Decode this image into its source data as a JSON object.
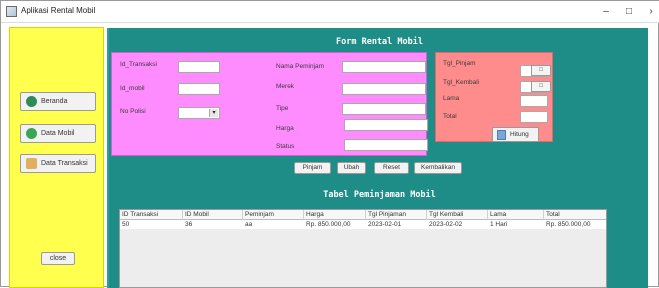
{
  "window": {
    "title": "Aplikasi Rental Mobil",
    "minimize": "–",
    "maximize": "□",
    "close": "›"
  },
  "sidebar": {
    "items": [
      {
        "label": "Beranda",
        "icon": "home-icon"
      },
      {
        "label": "Data Mobil",
        "icon": "car-icon"
      },
      {
        "label": "Data Transaksi",
        "icon": "handshake-icon"
      }
    ],
    "close_label": "close"
  },
  "form": {
    "title": "Form Rental Mobil",
    "left_panel": {
      "id_transaksi": "Id_Transaksi",
      "id_mobil": "Id_mobil",
      "no_polisi": "No Polisi"
    },
    "middle": {
      "nama_peminjam": "Nama Peminjam",
      "merek": "Merek",
      "tipe": "Tipe",
      "harga": "Harga",
      "status": "Status"
    },
    "right_panel": {
      "tgl_pinjam": "Tgl_Pinjam",
      "tgl_kembali": "Tgl_Kembali",
      "lama": "Lama",
      "total": "Total",
      "hitung": "Hitung"
    },
    "buttons": {
      "pinjam": "Pinjam",
      "ubah": "Ubah",
      "reset": "Reset",
      "kembalikan": "Kembalikan"
    }
  },
  "table": {
    "title": "Tabel Peminjaman Mobil",
    "columns": [
      "ID Transaksi",
      "ID Mobil",
      "Peminjam",
      "Harga",
      "Tgl Pinjaman",
      "Tgl Kembali",
      "Lama",
      "Total"
    ],
    "rows": [
      [
        "50",
        "36",
        "aa",
        "Rp. 850.000,00",
        "2023-02-01",
        "2023-02-02",
        "1 Hari",
        "Rp. 850.000,00"
      ]
    ]
  },
  "colors": {
    "sidebar": "#ffff4d",
    "main": "#1e8c87",
    "pink_panel": "#ff8cff",
    "salmon_panel": "#ff8c8c"
  }
}
